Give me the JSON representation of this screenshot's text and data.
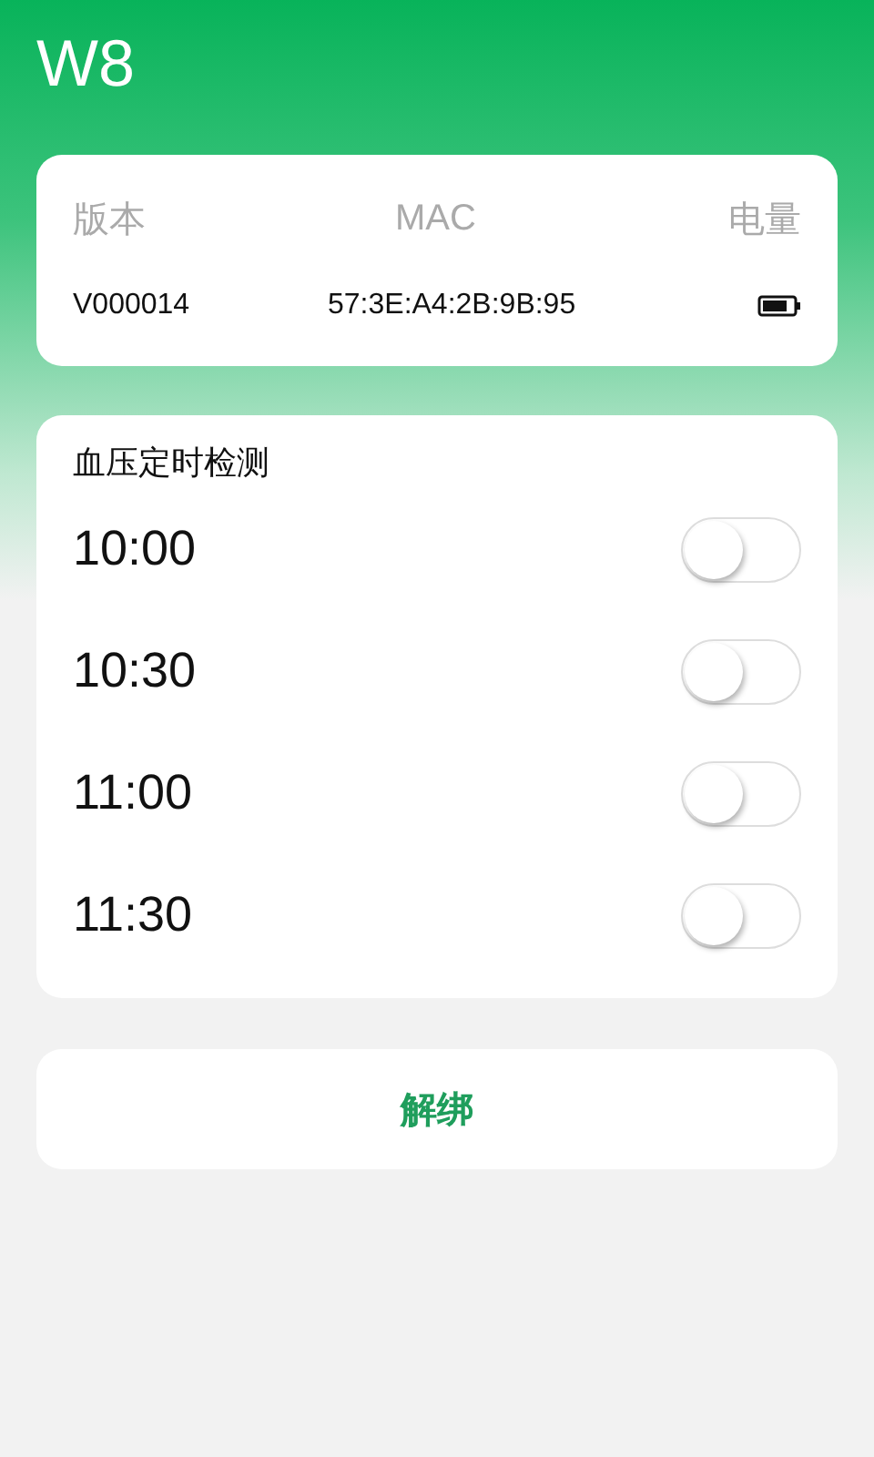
{
  "app_title": "W8",
  "device_info": {
    "columns": [
      "版本",
      "MAC",
      "电量"
    ],
    "version": "V000014",
    "mac": "57:3E:A4:2B:9B:95"
  },
  "schedule": {
    "title": "血压定时检测",
    "times": [
      {
        "time": "10:00",
        "on": false
      },
      {
        "time": "10:30",
        "on": false
      },
      {
        "time": "11:00",
        "on": false
      },
      {
        "time": "11:30",
        "on": false
      }
    ]
  },
  "unbind_button": "解绑"
}
